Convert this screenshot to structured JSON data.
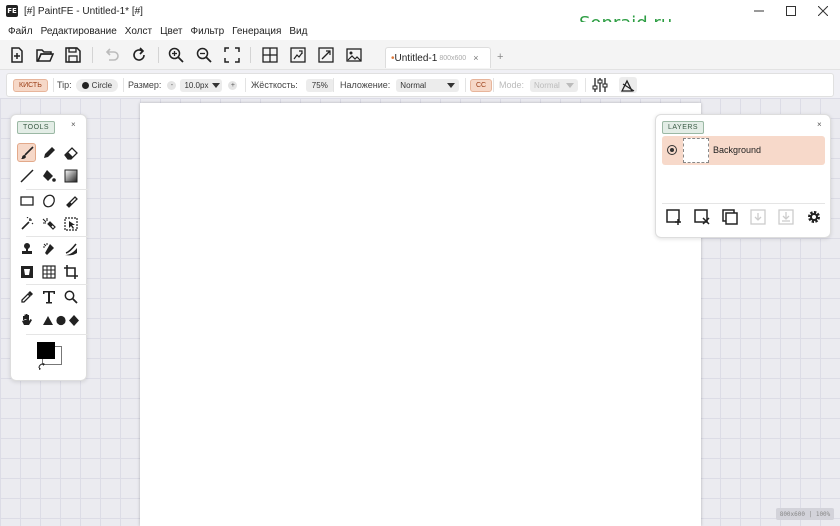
{
  "window": {
    "logo_text": "FE",
    "title": "[#] PaintFE - Untitled-1* [#]",
    "watermark": "Sonraid.ru",
    "controls": [
      "minimize",
      "maximize",
      "close"
    ]
  },
  "menu": [
    "Файл",
    "Редактирование",
    "Холст",
    "Цвет",
    "Фильтр",
    "Генерация",
    "Вид"
  ],
  "toolbar": {
    "buttons": [
      "new-file",
      "open-folder",
      "save",
      "undo",
      "redo",
      "zoom-in",
      "zoom-out",
      "fit-screen",
      "grid",
      "image-resize",
      "canvas-resize",
      "image"
    ],
    "undo_disabled": true
  },
  "tabs": [
    {
      "modified_mark": "•",
      "name": "Untitled-1",
      "dims": "800x600",
      "close": "×"
    }
  ],
  "new_tab_label": "+",
  "brush_options": {
    "tool_name": "КИСТЬ",
    "tip_label": "Tip:",
    "tip_value": "Circle",
    "size_label": "Размер:",
    "size_minus": "-",
    "size_value": "10.0px",
    "size_plus": "+",
    "hardness_label": "Жёсткость:",
    "hardness_value": "75%",
    "blend_label": "Наложение:",
    "blend_value": "Normal",
    "cc_label": "CC",
    "mode_label": "Mode:",
    "mode_value": "Normal"
  },
  "tools_panel": {
    "title": "TOOLS",
    "close": "×",
    "active_tool": "brush",
    "primary_color": "#000000",
    "secondary_color": "#ffffff"
  },
  "layers_panel": {
    "title": "LAYERS",
    "close": "×",
    "layers": [
      {
        "name": "Background",
        "visible": true,
        "selected": true
      }
    ]
  },
  "status": {
    "zoom_text": "800x600 | 100%"
  },
  "colors": {
    "accent": "#f6d8c8",
    "accent_border": "#e3a98a",
    "watermark": "#2e9e44",
    "tag_green": "#e3ede6"
  }
}
